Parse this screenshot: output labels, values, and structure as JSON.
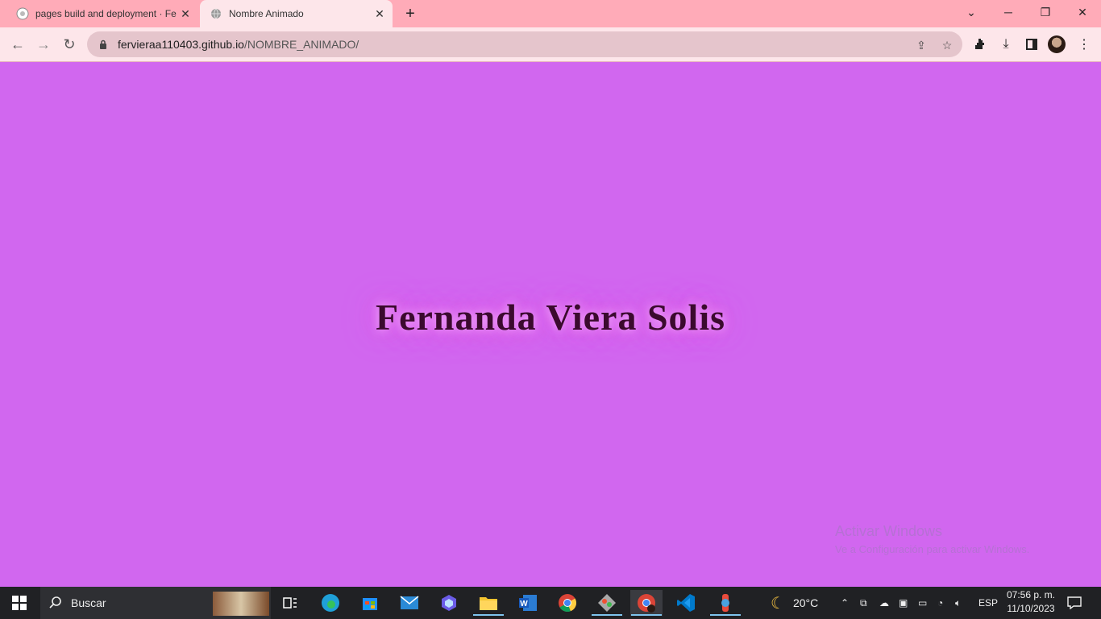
{
  "browser": {
    "tabs": [
      {
        "title": "pages build and deployment · Fe",
        "active": false
      },
      {
        "title": "Nombre Animado",
        "active": true
      }
    ],
    "url_host": "fervieraa110403.github.io",
    "url_path": "/NOMBRE_ANIMADO/"
  },
  "page": {
    "heading": "Fernanda Viera Solis",
    "background_color": "#d167ef",
    "glow_color": "#e25be8",
    "text_color": "#3b0a2e"
  },
  "watermark": {
    "line1": "Activar Windows",
    "line2": "Ve a Configuración para activar Windows."
  },
  "taskbar": {
    "search_label": "Buscar",
    "weather_temp": "20°C",
    "language": "ESP",
    "time": "07:56 p. m.",
    "date": "11/10/2023",
    "apps": [
      "task-view",
      "edge",
      "store",
      "mail",
      "copilot",
      "file-explorer",
      "word",
      "chrome",
      "git",
      "chrome-profile",
      "vscode",
      "app-extra"
    ]
  }
}
